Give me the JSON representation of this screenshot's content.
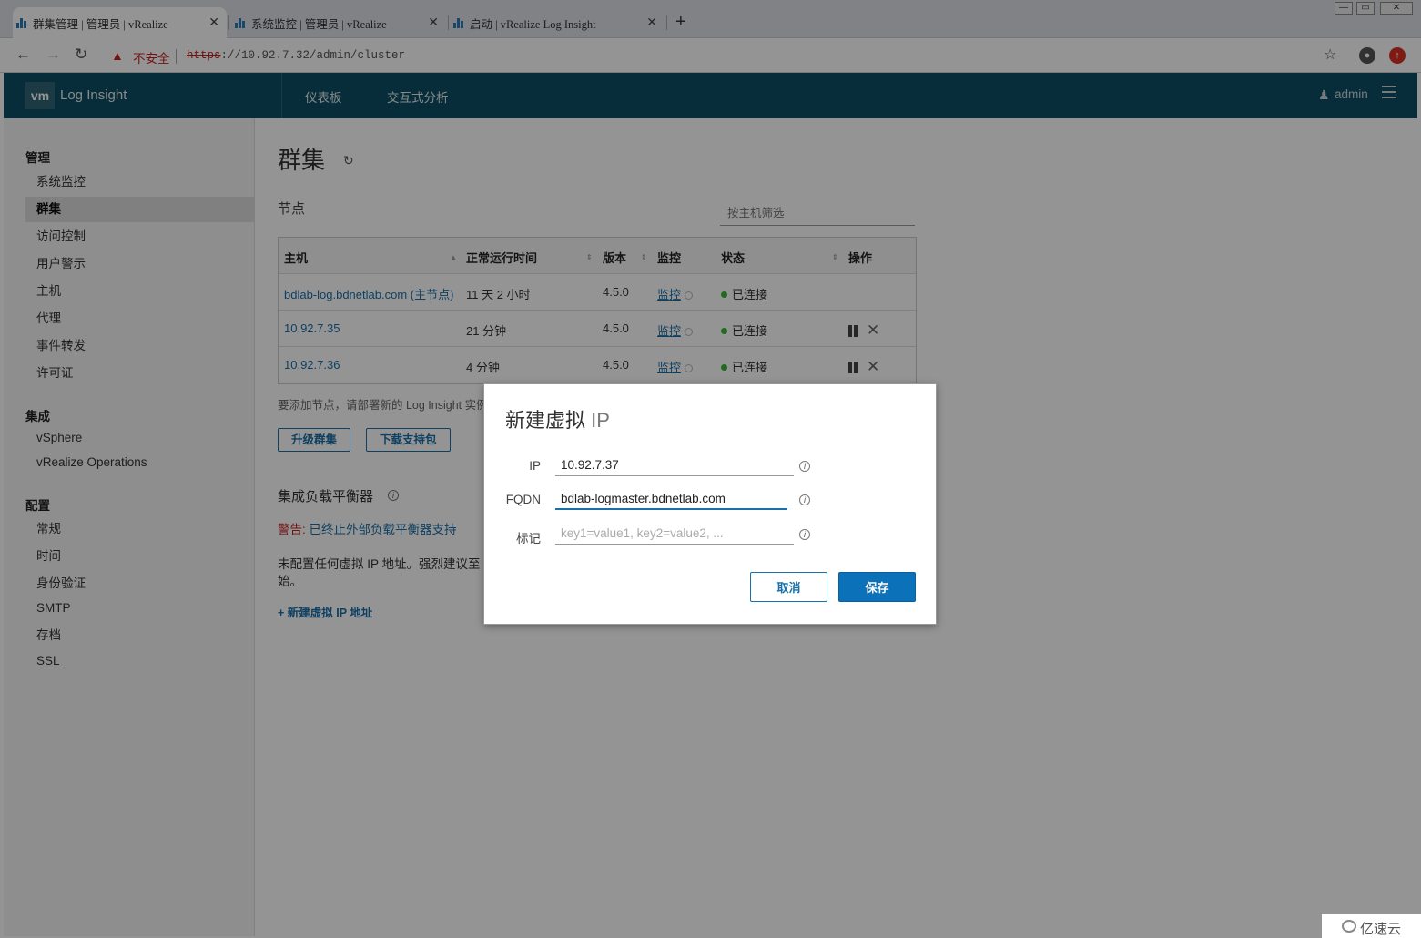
{
  "browser": {
    "tabs": [
      {
        "title": "群集管理 | 管理员 | vRealize",
        "active": true
      },
      {
        "title": "系统监控 | 管理员 | vRealize",
        "active": false
      },
      {
        "title": "启动 | vRealize Log Insight",
        "active": false
      }
    ],
    "new_tab": "+",
    "insecure_label": "不安全",
    "url_protocol": "https",
    "url_rest": "://10.92.7.32/admin/cluster",
    "window_controls": [
      "—",
      "▭",
      "✕"
    ]
  },
  "app": {
    "logo": "vm",
    "name": "Log Insight",
    "nav": [
      "仪表板",
      "交互式分析"
    ],
    "user": "admin",
    "header_color": "#0f4f64"
  },
  "sidebar": {
    "sections": [
      {
        "heading": "管理",
        "items": [
          "系统监控",
          "群集",
          "访问控制",
          "用户警示",
          "主机",
          "代理",
          "事件转发",
          "许可证"
        ]
      },
      {
        "heading": "集成",
        "items": [
          "vSphere",
          "vRealize Operations"
        ]
      },
      {
        "heading": "配置",
        "items": [
          "常规",
          "时间",
          "身份验证",
          "SMTP",
          "存档",
          "SSL"
        ]
      }
    ],
    "selected": "群集"
  },
  "main": {
    "title": "群集",
    "nodes_heading": "节点",
    "filter_placeholder": "按主机筛选",
    "table": {
      "headers": [
        "主机",
        "正常运行时间",
        "版本",
        "监控",
        "状态",
        "操作"
      ],
      "rows": [
        {
          "host": "bdlab-log.bdnetlab.com (主节点)",
          "uptime": "11 天 2 小时",
          "version": "4.5.0",
          "monitor": "监控",
          "status": "已连接",
          "actions": false
        },
        {
          "host": "10.92.7.35",
          "uptime": "21 分钟",
          "version": "4.5.0",
          "monitor": "监控",
          "status": "已连接",
          "actions": true
        },
        {
          "host": "10.92.7.36",
          "uptime": "4 分钟",
          "version": "4.5.0",
          "monitor": "监控",
          "status": "已连接",
          "actions": true
        }
      ]
    },
    "add_node_note": "要添加节点，请部署新的 Log Insight 实例",
    "upgrade_button": "升级群集",
    "download_button": "下载支持包",
    "lb_heading": "集成负载平衡器",
    "lb_warning_prefix": "警告:",
    "lb_warning_link": "已终止外部负载平衡器支持",
    "vip_note": "未配置任何虚拟 IP 地址。强烈建议至",
    "vip_note_cont": "始。",
    "new_vip_link": "+ 新建虚拟 IP 地址"
  },
  "dialog": {
    "title_main": "新建虚拟",
    "title_ip": "IP",
    "fields": [
      {
        "label": "IP",
        "value": "10.92.7.37",
        "placeholder": ""
      },
      {
        "label": "FQDN",
        "value": "bdlab-logmaster.bdnetlab.com",
        "placeholder": ""
      },
      {
        "label": "标记",
        "value": "",
        "placeholder": "key1=value1, key2=value2, ..."
      }
    ],
    "cancel": "取消",
    "save": "保存"
  },
  "watermark": "亿速云"
}
